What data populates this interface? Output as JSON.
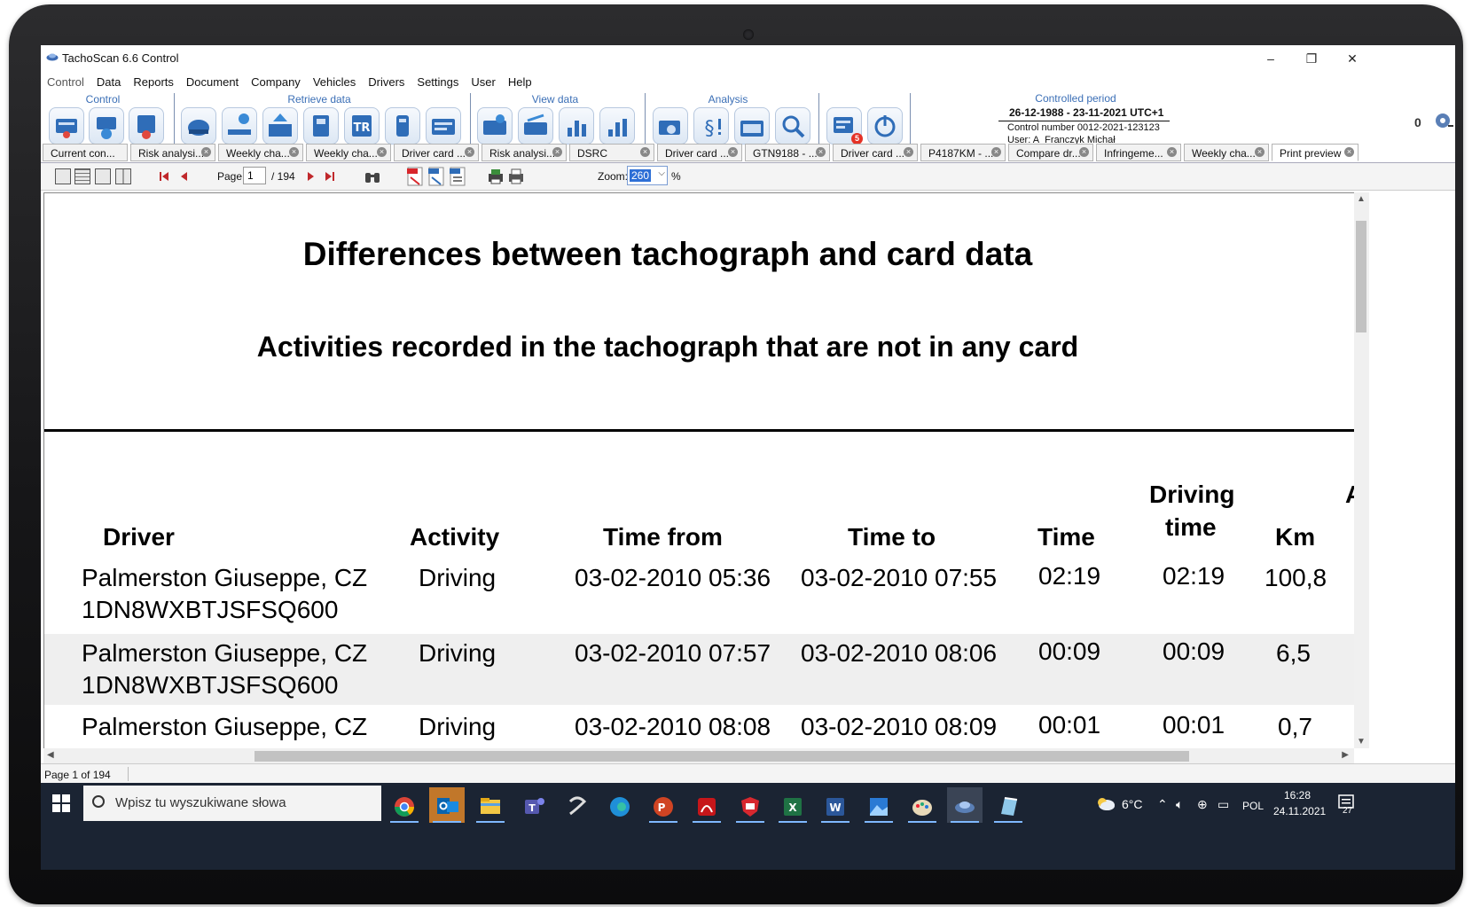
{
  "window": {
    "title": "TachoScan 6.6 Control",
    "minimize": "–",
    "restore": "❐",
    "close": "✕"
  },
  "menu": [
    "Control",
    "Data",
    "Reports",
    "Document",
    "Company",
    "Vehicles",
    "Drivers",
    "Settings",
    "User",
    "Help"
  ],
  "toolbar": {
    "groups": {
      "control": "Control",
      "retrieve": "Retrieve data",
      "view": "View data",
      "analysis": "Analysis"
    },
    "notification_count": "5",
    "controlled_period": {
      "title": "Controlled period",
      "range": "26-12-1988 - 23-11-2021 UTC+1",
      "control_number": "Control number 0012-2021-123123",
      "user": "User: A_Franczyk Michał"
    },
    "counter": "0"
  },
  "tabs": [
    "Current con...",
    "Risk analysi...",
    "Weekly cha...",
    "Weekly cha...",
    "Driver card ...",
    "Risk analysi...",
    "DSRC",
    "Driver card ...",
    "GTN9188 - ...",
    "Driver card ...",
    "P4187KM - ...",
    "Compare dr...",
    "Infringeme...",
    "Weekly cha...",
    "Print preview"
  ],
  "preview": {
    "page_label": "Page",
    "page_value": "1",
    "page_total": "/ 194",
    "zoom_label": "Zoom:",
    "zoom_value": "260",
    "zoom_unit": "%"
  },
  "document": {
    "title": "Differences between tachograph and card data",
    "subtitle": "Activities recorded in the tachograph that are not in any card",
    "columns": {
      "driver": "Driver",
      "activity": "Activity",
      "time_from": "Time from",
      "time_to": "Time to",
      "time": "Time",
      "driving_time_1": "Driving",
      "driving_time_2": "time",
      "km": "Km",
      "extra": "A"
    },
    "rows": [
      {
        "driver_1": "Palmerston Giuseppe, CZ",
        "driver_2": "1DN8WXBTJSFSQ600",
        "activity": "Driving",
        "time_from": "03-02-2010 05:36",
        "time_to": "03-02-2010 07:55",
        "time": "02:19",
        "driving_time": "02:19",
        "km": "100,8"
      },
      {
        "driver_1": "Palmerston Giuseppe, CZ",
        "driver_2": "1DN8WXBTJSFSQ600",
        "activity": "Driving",
        "time_from": "03-02-2010 07:57",
        "time_to": "03-02-2010 08:06",
        "time": "00:09",
        "driving_time": "00:09",
        "km": "6,5"
      },
      {
        "driver_1": "Palmerston Giuseppe, CZ",
        "activity": "Driving",
        "time_from": "03-02-2010 08:08",
        "time_to": "03-02-2010 08:09",
        "time": "00:01",
        "driving_time": "00:01",
        "km": "0,7"
      }
    ]
  },
  "status": {
    "page": "Page 1 of 194"
  },
  "taskbar": {
    "search_placeholder": "Wpisz tu wyszukiwane słowa",
    "weather": "6°C",
    "language": "POL",
    "time": "16:28",
    "date": "24.11.2021",
    "notifications": "27"
  }
}
